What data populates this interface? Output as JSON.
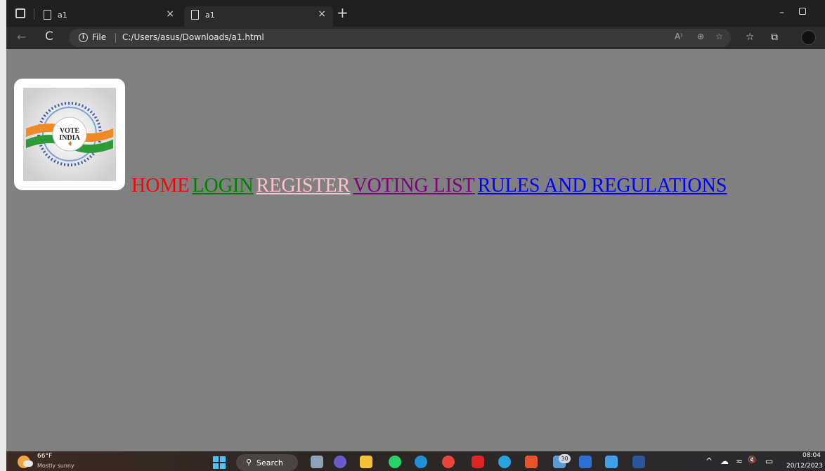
{
  "browser": {
    "tabs": [
      {
        "title": "a1",
        "close": "×"
      },
      {
        "title": "a1",
        "close": "×"
      }
    ],
    "new_tab": "+",
    "minimize": "–",
    "back": "←",
    "refresh": "C",
    "address": {
      "info": "i",
      "scheme_label": "File",
      "url": "C:/Users/asus/Downloads/a1.html"
    },
    "addr_icons": [
      "A⁾",
      "⊕",
      "☆"
    ],
    "toolbar_icons": [
      "☆",
      "⧉"
    ]
  },
  "page": {
    "logo": {
      "line1": "VOTE",
      "line2": "INDIA"
    },
    "nav": {
      "home": "HOME",
      "login": "LOGIN",
      "register": "REGISTER",
      "voting_list": "VOTING LIST",
      "rules": "RULES AND REGULATIONS"
    },
    "colors": {
      "background": "#808080",
      "home": "#ff0000",
      "login": "#008000",
      "register": "#ffc0cb",
      "voting_list": "#800080",
      "rules": "#0000ff"
    }
  },
  "taskbar": {
    "weather": {
      "temp": "66°F",
      "condition": "Mostly sunny"
    },
    "search_label": "Search",
    "mail_badge": "30",
    "tray": [
      "^",
      "☁",
      "≈",
      "🔇",
      "▭"
    ],
    "clock": {
      "time": "08:04",
      "date": "20/12/2023"
    }
  }
}
